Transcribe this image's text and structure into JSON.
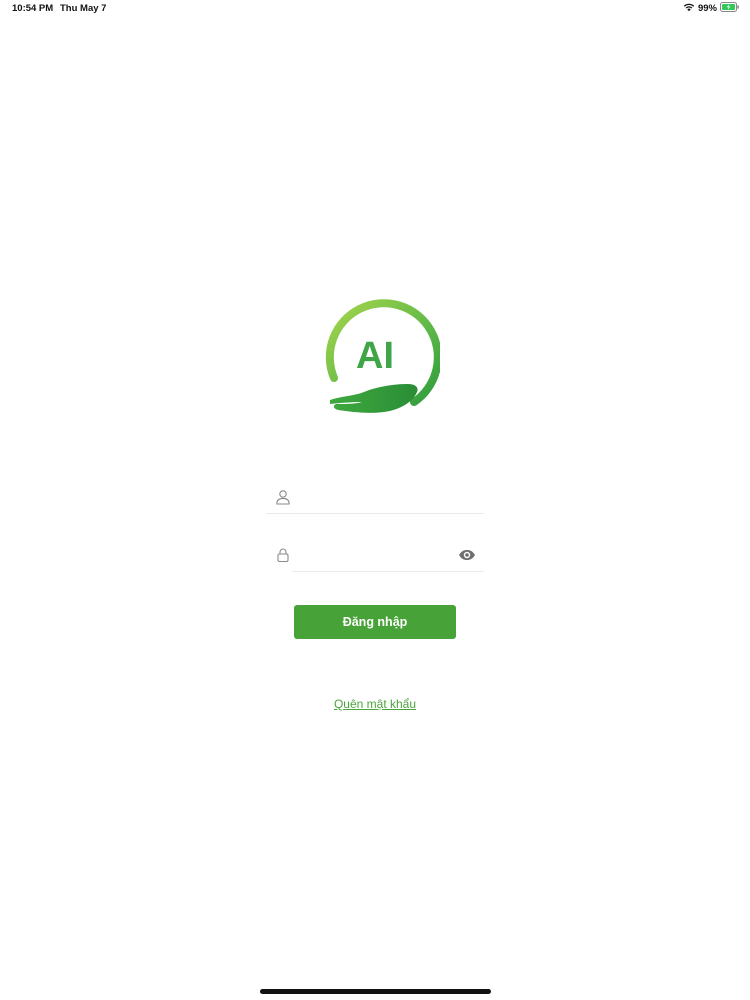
{
  "status_bar": {
    "time": "10:54 PM",
    "date": "Thu May 7",
    "battery_percent": "99%",
    "icons": [
      "wifi-icon",
      "battery-charging-icon"
    ]
  },
  "logo": {
    "text": "AI",
    "colors": {
      "light_green": "#9fd14a",
      "dark_green": "#2e9a3c"
    }
  },
  "login_form": {
    "username": {
      "value": "",
      "placeholder": "",
      "icon": "user-icon"
    },
    "password": {
      "value": "",
      "placeholder": "",
      "icon": "lock-icon",
      "toggle_icon": "eye-icon"
    },
    "submit_label": "Đăng nhập",
    "forgot_password_label": "Quên mật khẩu"
  },
  "colors": {
    "accent": "#47a337",
    "link": "#4aa43c",
    "divider": "#e9e9e9"
  }
}
